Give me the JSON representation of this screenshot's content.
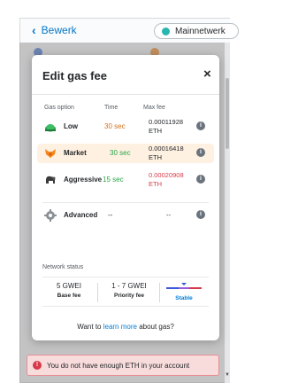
{
  "topbar": {
    "back_label": "Bewerk",
    "network_label": "Mainnetwerk"
  },
  "modal": {
    "title": "Edit gas fee",
    "close_symbol": "×",
    "columns": {
      "option": "Gas option",
      "time": "Time",
      "max_fee": "Max fee"
    },
    "options": [
      {
        "name": "Low",
        "time": "30 sec",
        "fee_line1": "0.00011928",
        "fee_line2": "ETH",
        "icon": "turtle-icon",
        "selected": false
      },
      {
        "name": "Market",
        "time": "30 sec",
        "fee_line1": "0.00016418",
        "fee_line2": "ETH",
        "icon": "fox-icon",
        "selected": true
      },
      {
        "name": "Aggressive",
        "time": "15 sec",
        "fee_line1": "0.00020908",
        "fee_line2": "ETH",
        "icon": "gorilla-icon",
        "selected": false
      },
      {
        "name": "Advanced",
        "time": "--",
        "fee_line1": "--",
        "fee_line2": "",
        "icon": "gear-icon",
        "selected": false
      }
    ],
    "info_symbol": "i",
    "network_status": {
      "label": "Network status",
      "base_fee_value": "5 GWEI",
      "base_fee_label": "Base fee",
      "priority_fee_value": "1 - 7 GWEI",
      "priority_fee_label": "Priority fee",
      "trend_label": "Stable"
    },
    "footer": {
      "prefix": "Want to ",
      "link": "learn more",
      "suffix": " about gas?"
    }
  },
  "warning": {
    "text": "You do not have enough ETH in your account"
  },
  "colors": {
    "accent": "#037dd6",
    "selected_row": "#fff1e2",
    "low_time": "#d4711a",
    "market_time": "#28a745",
    "aggressive_time": "#28a745",
    "aggressive_fee": "#d73a49",
    "warning_bg": "#f8dcdc"
  }
}
